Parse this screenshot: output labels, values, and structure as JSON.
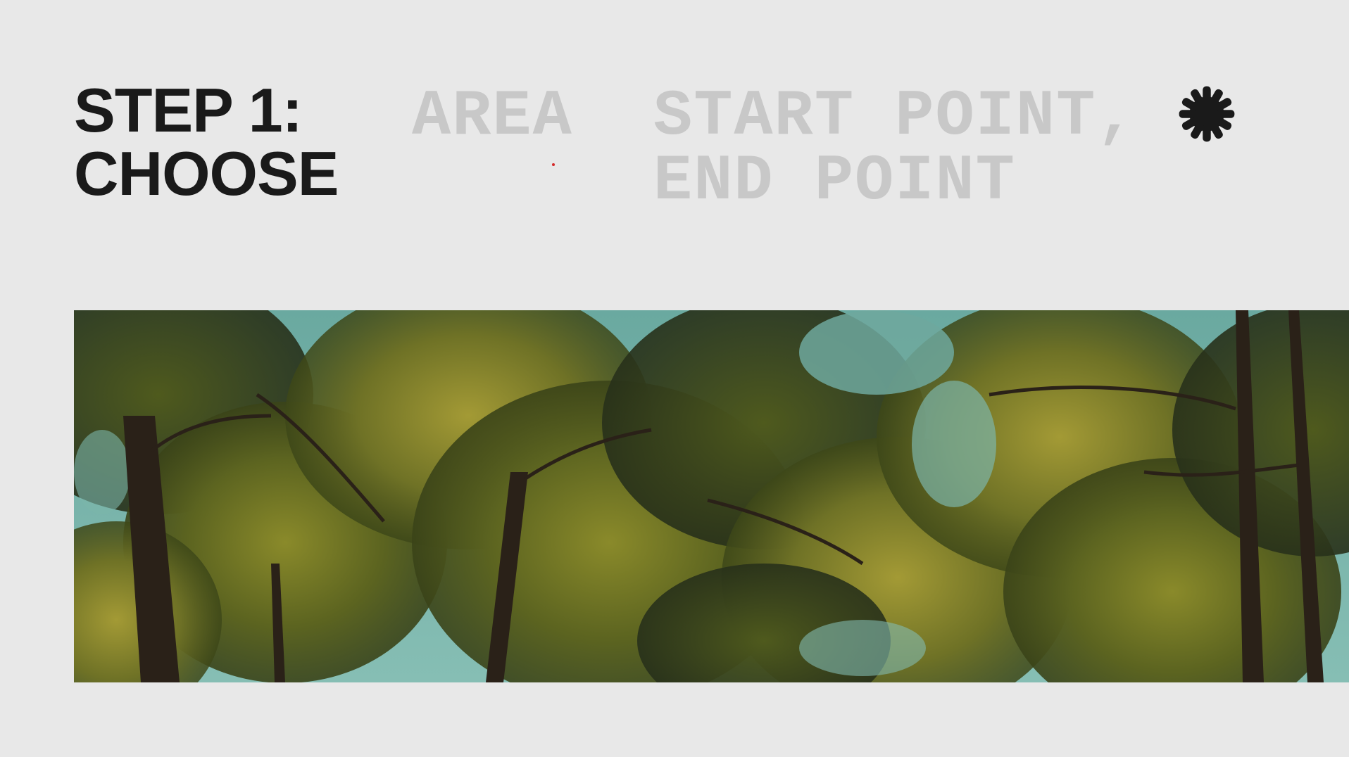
{
  "heading": {
    "line1": "STEP 1:",
    "line2": "CHOOSE"
  },
  "options": [
    {
      "lines": [
        "AREA"
      ]
    },
    {
      "lines": [
        "START POINT,",
        "END POINT"
      ]
    }
  ],
  "icons": {
    "corner_icon": "asterisk-icon"
  },
  "hero_image": {
    "subject": "pine-tree-canopy-photo"
  },
  "colors": {
    "background": "#e8e8e8",
    "heading": "#1a1a1a",
    "inactive_option": "#c8c8c8",
    "cursor_dot": "#d42a2a"
  }
}
